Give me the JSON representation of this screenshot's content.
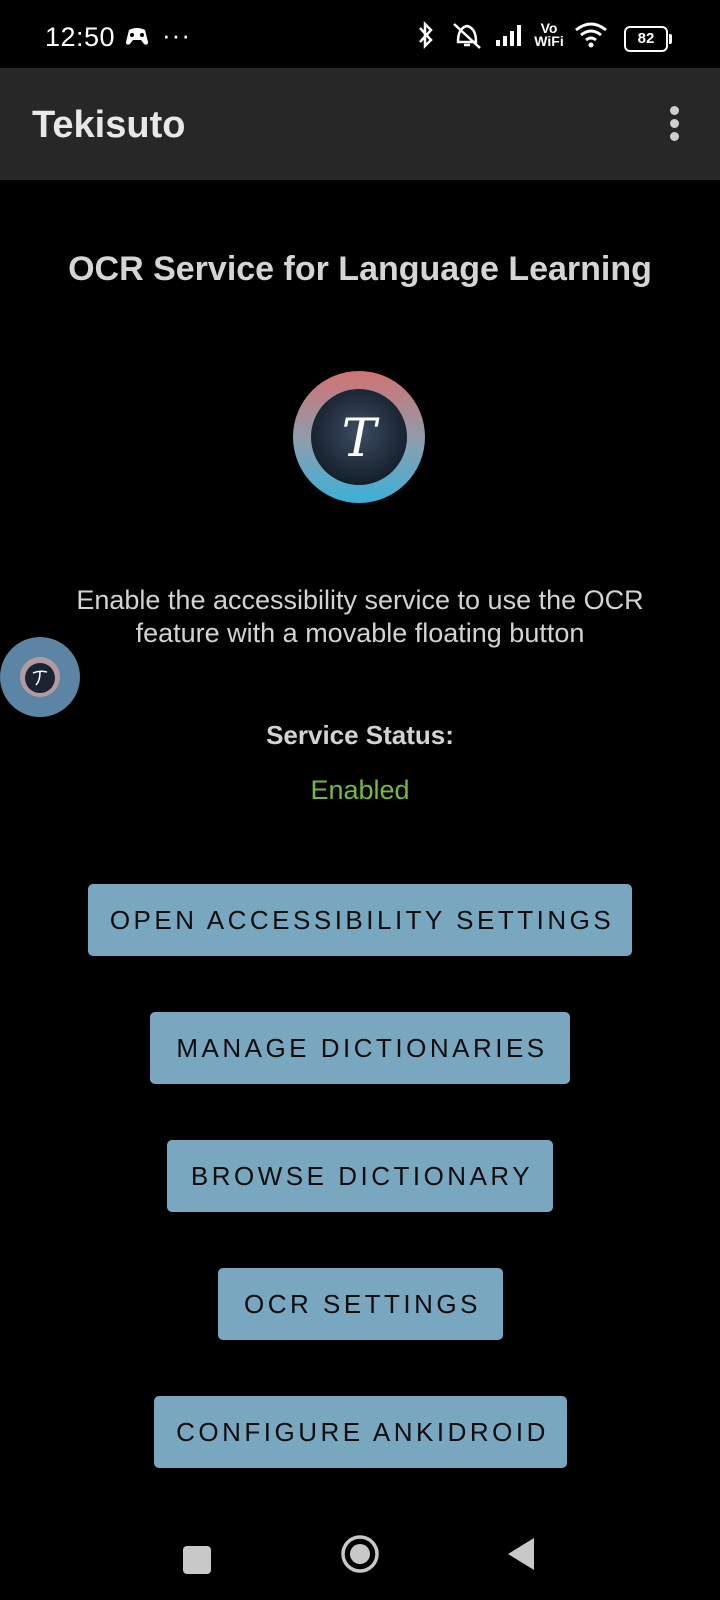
{
  "status_bar": {
    "time": "12:50",
    "notification_dots": "···",
    "network_label": "Vo\nWiFi",
    "battery_level": "82"
  },
  "app_bar": {
    "title": "Tekisuto"
  },
  "main": {
    "headline": "OCR Service for Language Learning",
    "logo_letter": "T",
    "description": "Enable the accessibility service to use the OCR feature with a movable floating button",
    "status_label": "Service Status:",
    "status_value": "Enabled",
    "buttons": [
      {
        "label": "OPEN ACCESSIBILITY SETTINGS"
      },
      {
        "label": "MANAGE DICTIONARIES"
      },
      {
        "label": "BROWSE DICTIONARY"
      },
      {
        "label": "OCR SETTINGS"
      },
      {
        "label": "CONFIGURE ANKIDROID"
      }
    ]
  },
  "colors": {
    "background": "#000000",
    "app_bar": "#272727",
    "button": "#7aa7c0",
    "status_enabled": "#76b93c"
  }
}
